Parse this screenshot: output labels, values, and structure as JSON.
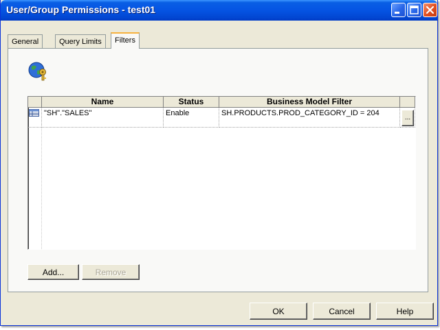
{
  "window": {
    "title": "User/Group Permissions - test01"
  },
  "tabs": [
    {
      "label": "General",
      "active": false
    },
    {
      "label": "Query Limits",
      "active": false
    },
    {
      "label": "Filters",
      "active": true
    }
  ],
  "grid": {
    "columns": [
      "Name",
      "Status",
      "Business Model Filter"
    ],
    "rows": [
      {
        "name": "\"SH\".\"SALES\"",
        "status": "Enable",
        "filter": "SH.PRODUCTS.PROD_CATEGORY_ID = 204",
        "edit_label": "..."
      }
    ]
  },
  "panel_buttons": {
    "add": "Add...",
    "remove": "Remove"
  },
  "dialog_buttons": {
    "ok": "OK",
    "cancel": "Cancel",
    "help": "Help"
  },
  "colors": {
    "titlebar": "#0554e3",
    "face": "#ece9d8",
    "close": "#e24e1f"
  }
}
